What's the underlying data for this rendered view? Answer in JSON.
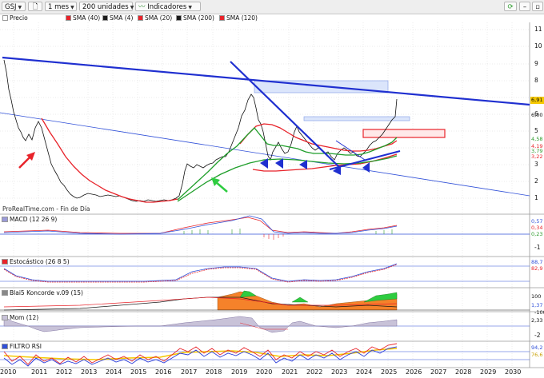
{
  "toolbar": {
    "symbol": "GSJ",
    "period": "1 mes",
    "units": "200 unidades",
    "indicators_label": "Indicadores"
  },
  "legend": {
    "price": "Precio",
    "items": [
      {
        "label": "SMA (40)",
        "color": "#e8232a"
      },
      {
        "label": "SMA (4)",
        "color": "#1a1a1a"
      },
      {
        "label": "SMA (20)",
        "color": "#e8232a"
      },
      {
        "label": "SMA (200)",
        "color": "#1a1a1a"
      },
      {
        "label": "SMA (120)",
        "color": "#e8232a"
      }
    ]
  },
  "watermark": "ProRealTime.com - Fin de Día",
  "panels": {
    "macd": "MACD (12 26 9)",
    "stoch": "Estocástico (26 8 5)",
    "koncorde": "Blai5 Koncorde v.09 (15)",
    "mom": "Mom (12)",
    "rsi": "FILTRO RSI"
  },
  "price_axis": [
    "11",
    "10",
    "9",
    "8",
    "7",
    "6",
    "5",
    "4",
    "3",
    "2",
    "1"
  ],
  "price_tags": [
    {
      "text": "6,91",
      "color": "#f5c800"
    },
    {
      "text": "6,00",
      "color": "#ffffff"
    },
    {
      "text": "4,58",
      "color": "#ffffff"
    },
    {
      "text": "4,19",
      "color": "#ffffff"
    },
    {
      "text": "3,79",
      "color": "#ffffff"
    },
    {
      "text": "3,22",
      "color": "#ffffff"
    }
  ],
  "macd_tags": [
    "0,57",
    "0,34",
    "0,23"
  ],
  "macd_axis": [
    "-1"
  ],
  "stoch_tags": [
    "88,7",
    "82,9"
  ],
  "koncorde_tags": [
    "100",
    "1,37"
  ],
  "koncorde_axis": [
    "-100"
  ],
  "mom_tags": [
    "2,33"
  ],
  "mom_axis": [
    "-2"
  ],
  "rsi_tags": [
    "94,2",
    "76,6"
  ],
  "years": [
    "2010",
    "2011",
    "2012",
    "2013",
    "2014",
    "2015",
    "2016",
    "2017",
    "2018",
    "2019",
    "2020",
    "2021",
    "2022",
    "2023",
    "2024",
    "2025",
    "2026",
    "2027",
    "2028",
    "2029",
    "2030"
  ]
}
